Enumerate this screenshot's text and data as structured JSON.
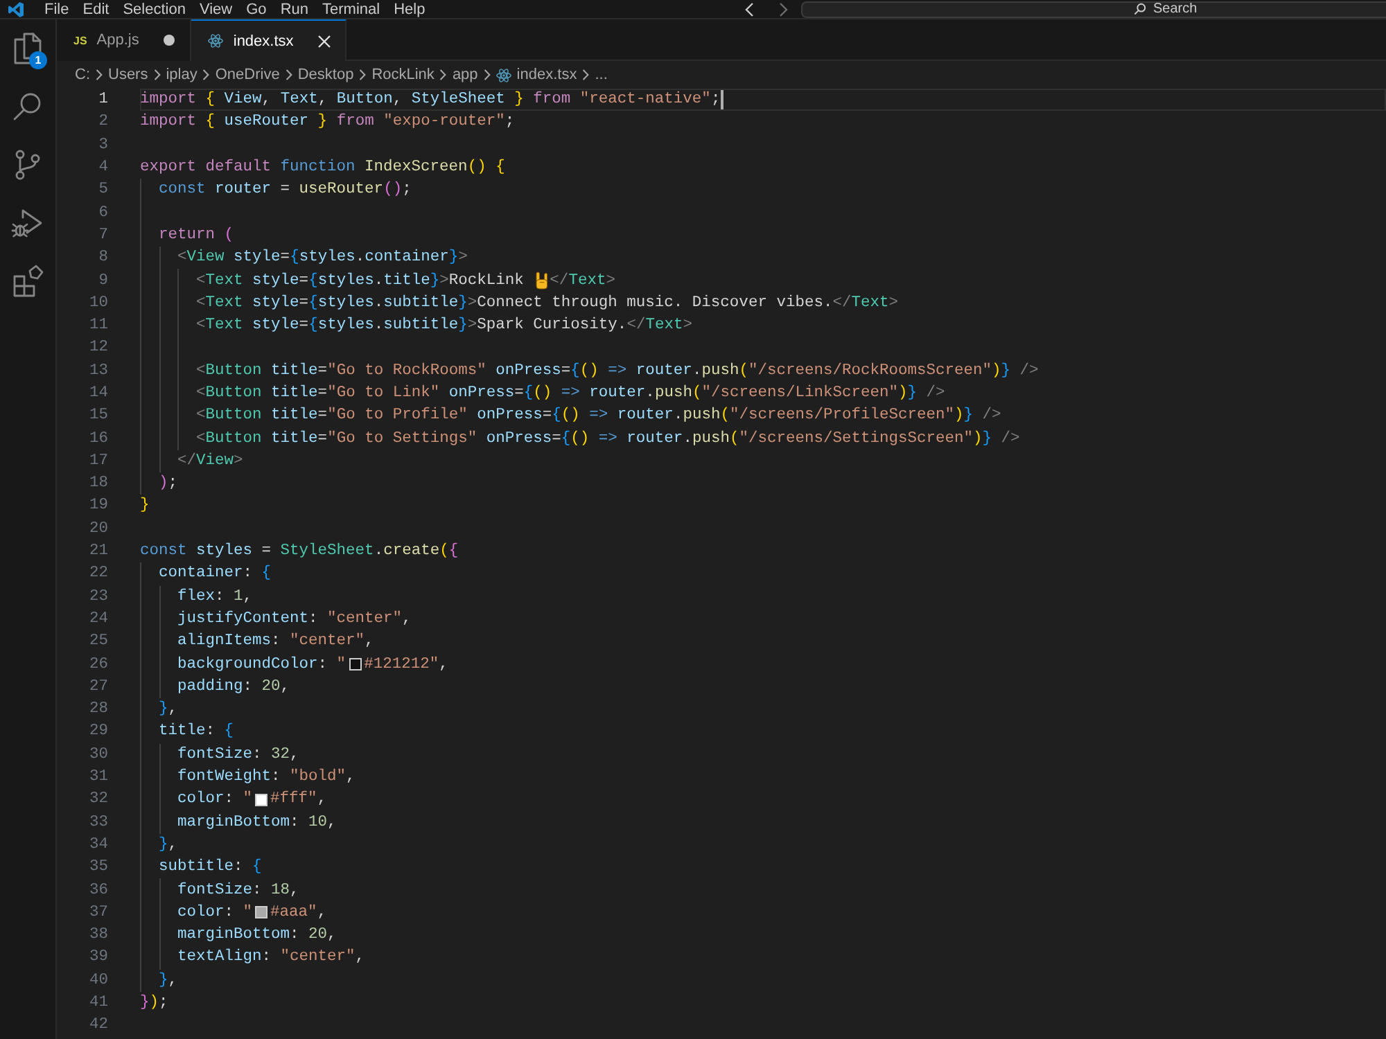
{
  "title_bar": {
    "menu": [
      "File",
      "Edit",
      "Selection",
      "View",
      "Go",
      "Run",
      "Terminal",
      "Help"
    ],
    "search": {
      "placeholder": "Search"
    }
  },
  "activity_bar": {
    "items": [
      {
        "kind": "explorer",
        "badge": "1"
      },
      {
        "kind": "search"
      },
      {
        "kind": "source_control"
      },
      {
        "kind": "run_debug"
      },
      {
        "kind": "extensions"
      }
    ]
  },
  "tabs": [
    {
      "kind": "js",
      "icon_text": "JS",
      "label": "App.js",
      "selected": false,
      "modified": true
    },
    {
      "kind": "react",
      "label": "index.tsx",
      "selected": true,
      "modified": false
    }
  ],
  "breadcrumbs": [
    {
      "kind": "segment",
      "label": "C:"
    },
    {
      "kind": "segment",
      "label": "Users"
    },
    {
      "kind": "segment",
      "label": "iplay"
    },
    {
      "kind": "segment",
      "label": "OneDrive"
    },
    {
      "kind": "segment",
      "label": "Desktop"
    },
    {
      "kind": "segment",
      "label": "RockLink"
    },
    {
      "kind": "segment",
      "label": "app"
    },
    {
      "kind": "file",
      "label": "index.tsx"
    },
    {
      "kind": "segment",
      "label": "..."
    }
  ],
  "editor": {
    "lines": [
      {
        "number": "1",
        "current": true,
        "tokens": [
          {
            "kind": "keyword",
            "text": "import "
          },
          {
            "kind": "bracket1",
            "text": "{"
          },
          {
            "kind": "variable",
            "text": " View"
          },
          {
            "kind": "plain",
            "text": ","
          },
          {
            "kind": "variable",
            "text": " Text"
          },
          {
            "kind": "plain",
            "text": ","
          },
          {
            "kind": "variable",
            "text": " Button"
          },
          {
            "kind": "plain",
            "text": ","
          },
          {
            "kind": "variable",
            "text": " StyleSheet "
          },
          {
            "kind": "bracket1",
            "text": "}"
          },
          {
            "kind": "keyword",
            "text": " from "
          },
          {
            "kind": "string",
            "text": "\"react-native\""
          },
          {
            "kind": "plain",
            "text": ";"
          }
        ]
      },
      {
        "number": "2",
        "current": false,
        "tokens": [
          {
            "kind": "keyword",
            "text": "import "
          },
          {
            "kind": "bracket1",
            "text": "{"
          },
          {
            "kind": "variable",
            "text": " useRouter "
          },
          {
            "kind": "bracket1",
            "text": "}"
          },
          {
            "kind": "keyword",
            "text": " from "
          },
          {
            "kind": "string",
            "text": "\"expo-router\""
          },
          {
            "kind": "plain",
            "text": ";"
          }
        ]
      },
      {
        "number": "3",
        "current": false
      },
      {
        "number": "4",
        "current": false,
        "tokens": [
          {
            "kind": "keyword",
            "text": "export default "
          },
          {
            "kind": "storage",
            "text": "function "
          },
          {
            "kind": "function",
            "text": "IndexScreen"
          },
          {
            "kind": "bracket1",
            "text": "() {"
          }
        ]
      },
      {
        "number": "5",
        "current": false,
        "tokens": [
          {
            "kind": "storage",
            "text": "  const "
          },
          {
            "kind": "variable",
            "text": "router"
          },
          {
            "kind": "plain",
            "text": " = "
          },
          {
            "kind": "function",
            "text": "useRouter"
          },
          {
            "kind": "bracket2",
            "text": "()"
          },
          {
            "kind": "plain",
            "text": ";"
          }
        ]
      },
      {
        "number": "6",
        "current": false
      },
      {
        "number": "7",
        "current": false,
        "tokens": [
          {
            "kind": "keyword",
            "text": "  return "
          },
          {
            "kind": "bracket2",
            "text": "("
          }
        ]
      },
      {
        "number": "8",
        "current": false,
        "tokens": [
          {
            "kind": "punctuation",
            "text": "    <"
          },
          {
            "kind": "tag",
            "text": "View"
          },
          {
            "kind": "variable",
            "text": " style"
          },
          {
            "kind": "plain",
            "text": "="
          },
          {
            "kind": "bracket3",
            "text": "{"
          },
          {
            "kind": "variable",
            "text": "styles"
          },
          {
            "kind": "plain",
            "text": "."
          },
          {
            "kind": "variable",
            "text": "container"
          },
          {
            "kind": "bracket3",
            "text": "}"
          },
          {
            "kind": "punctuation",
            "text": ">"
          }
        ]
      },
      {
        "number": "9",
        "current": false,
        "tokens": [
          {
            "kind": "punctuation",
            "text": "      <"
          },
          {
            "kind": "tag",
            "text": "Text"
          },
          {
            "kind": "variable",
            "text": " style"
          },
          {
            "kind": "plain",
            "text": "="
          },
          {
            "kind": "bracket3",
            "text": "{"
          },
          {
            "kind": "variable",
            "text": "styles"
          },
          {
            "kind": "plain",
            "text": "."
          },
          {
            "kind": "variable",
            "text": "title"
          },
          {
            "kind": "bracket3",
            "text": "}"
          },
          {
            "kind": "punctuation",
            "text": ">"
          },
          {
            "kind": "plain",
            "text": "RockLink "
          },
          {
            "kind": "emoji"
          },
          {
            "kind": "punctuation",
            "text": "</"
          },
          {
            "kind": "tag",
            "text": "Text"
          },
          {
            "kind": "punctuation",
            "text": ">"
          }
        ]
      },
      {
        "number": "10",
        "current": false,
        "tokens": [
          {
            "kind": "punctuation",
            "text": "      <"
          },
          {
            "kind": "tag",
            "text": "Text"
          },
          {
            "kind": "variable",
            "text": " style"
          },
          {
            "kind": "plain",
            "text": "="
          },
          {
            "kind": "bracket3",
            "text": "{"
          },
          {
            "kind": "variable",
            "text": "styles"
          },
          {
            "kind": "plain",
            "text": "."
          },
          {
            "kind": "variable",
            "text": "subtitle"
          },
          {
            "kind": "bracket3",
            "text": "}"
          },
          {
            "kind": "punctuation",
            "text": ">"
          },
          {
            "kind": "plain",
            "text": "Connect through music. Discover vibes."
          },
          {
            "kind": "punctuation",
            "text": "</"
          },
          {
            "kind": "tag",
            "text": "Text"
          },
          {
            "kind": "punctuation",
            "text": ">"
          }
        ]
      },
      {
        "number": "11",
        "current": false,
        "tokens": [
          {
            "kind": "punctuation",
            "text": "      <"
          },
          {
            "kind": "tag",
            "text": "Text"
          },
          {
            "kind": "variable",
            "text": " style"
          },
          {
            "kind": "plain",
            "text": "="
          },
          {
            "kind": "bracket3",
            "text": "{"
          },
          {
            "kind": "variable",
            "text": "styles"
          },
          {
            "kind": "plain",
            "text": "."
          },
          {
            "kind": "variable",
            "text": "subtitle"
          },
          {
            "kind": "bracket3",
            "text": "}"
          },
          {
            "kind": "punctuation",
            "text": ">"
          },
          {
            "kind": "plain",
            "text": "Spark Curiosity."
          },
          {
            "kind": "punctuation",
            "text": "</"
          },
          {
            "kind": "tag",
            "text": "Text"
          },
          {
            "kind": "punctuation",
            "text": ">"
          }
        ]
      },
      {
        "number": "12",
        "current": false
      },
      {
        "number": "13",
        "current": false,
        "tokens": [
          {
            "kind": "punctuation",
            "text": "      <"
          },
          {
            "kind": "tag",
            "text": "Button"
          },
          {
            "kind": "variable",
            "text": " title"
          },
          {
            "kind": "plain",
            "text": "="
          },
          {
            "kind": "string",
            "text": "\"Go to RockRooms\""
          },
          {
            "kind": "variable",
            "text": " onPress"
          },
          {
            "kind": "plain",
            "text": "="
          },
          {
            "kind": "bracket3",
            "text": "{"
          },
          {
            "kind": "bracket1",
            "text": "()"
          },
          {
            "kind": "storage",
            "text": " => "
          },
          {
            "kind": "variable",
            "text": "router"
          },
          {
            "kind": "plain",
            "text": "."
          },
          {
            "kind": "function",
            "text": "push"
          },
          {
            "kind": "bracket1",
            "text": "("
          },
          {
            "kind": "string",
            "text": "\"/screens/RockRoomsScreen\""
          },
          {
            "kind": "bracket1",
            "text": ")"
          },
          {
            "kind": "bracket3",
            "text": "}"
          },
          {
            "kind": "punctuation",
            "text": " />"
          }
        ]
      },
      {
        "number": "14",
        "current": false,
        "tokens": [
          {
            "kind": "punctuation",
            "text": "      <"
          },
          {
            "kind": "tag",
            "text": "Button"
          },
          {
            "kind": "variable",
            "text": " title"
          },
          {
            "kind": "plain",
            "text": "="
          },
          {
            "kind": "string",
            "text": "\"Go to Link\""
          },
          {
            "kind": "variable",
            "text": " onPress"
          },
          {
            "kind": "plain",
            "text": "="
          },
          {
            "kind": "bracket3",
            "text": "{"
          },
          {
            "kind": "bracket1",
            "text": "()"
          },
          {
            "kind": "storage",
            "text": " => "
          },
          {
            "kind": "variable",
            "text": "router"
          },
          {
            "kind": "plain",
            "text": "."
          },
          {
            "kind": "function",
            "text": "push"
          },
          {
            "kind": "bracket1",
            "text": "("
          },
          {
            "kind": "string",
            "text": "\"/screens/LinkScreen\""
          },
          {
            "kind": "bracket1",
            "text": ")"
          },
          {
            "kind": "bracket3",
            "text": "}"
          },
          {
            "kind": "punctuation",
            "text": " />"
          }
        ]
      },
      {
        "number": "15",
        "current": false,
        "tokens": [
          {
            "kind": "punctuation",
            "text": "      <"
          },
          {
            "kind": "tag",
            "text": "Button"
          },
          {
            "kind": "variable",
            "text": " title"
          },
          {
            "kind": "plain",
            "text": "="
          },
          {
            "kind": "string",
            "text": "\"Go to Profile\""
          },
          {
            "kind": "variable",
            "text": " onPress"
          },
          {
            "kind": "plain",
            "text": "="
          },
          {
            "kind": "bracket3",
            "text": "{"
          },
          {
            "kind": "bracket1",
            "text": "()"
          },
          {
            "kind": "storage",
            "text": " => "
          },
          {
            "kind": "variable",
            "text": "router"
          },
          {
            "kind": "plain",
            "text": "."
          },
          {
            "kind": "function",
            "text": "push"
          },
          {
            "kind": "bracket1",
            "text": "("
          },
          {
            "kind": "string",
            "text": "\"/screens/ProfileScreen\""
          },
          {
            "kind": "bracket1",
            "text": ")"
          },
          {
            "kind": "bracket3",
            "text": "}"
          },
          {
            "kind": "punctuation",
            "text": " />"
          }
        ]
      },
      {
        "number": "16",
        "current": false,
        "tokens": [
          {
            "kind": "punctuation",
            "text": "      <"
          },
          {
            "kind": "tag",
            "text": "Button"
          },
          {
            "kind": "variable",
            "text": " title"
          },
          {
            "kind": "plain",
            "text": "="
          },
          {
            "kind": "string",
            "text": "\"Go to Settings\""
          },
          {
            "kind": "variable",
            "text": " onPress"
          },
          {
            "kind": "plain",
            "text": "="
          },
          {
            "kind": "bracket3",
            "text": "{"
          },
          {
            "kind": "bracket1",
            "text": "()"
          },
          {
            "kind": "storage",
            "text": " => "
          },
          {
            "kind": "variable",
            "text": "router"
          },
          {
            "kind": "plain",
            "text": "."
          },
          {
            "kind": "function",
            "text": "push"
          },
          {
            "kind": "bracket1",
            "text": "("
          },
          {
            "kind": "string",
            "text": "\"/screens/SettingsScreen\""
          },
          {
            "kind": "bracket1",
            "text": ")"
          },
          {
            "kind": "bracket3",
            "text": "}"
          },
          {
            "kind": "punctuation",
            "text": " />"
          }
        ]
      },
      {
        "number": "17",
        "current": false,
        "tokens": [
          {
            "kind": "punctuation",
            "text": "    </"
          },
          {
            "kind": "tag",
            "text": "View"
          },
          {
            "kind": "punctuation",
            "text": ">"
          }
        ]
      },
      {
        "number": "18",
        "current": false,
        "tokens": [
          {
            "kind": "bracket2",
            "text": "  )"
          },
          {
            "kind": "plain",
            "text": ";"
          }
        ]
      },
      {
        "number": "19",
        "current": false,
        "tokens": [
          {
            "kind": "bracket1",
            "text": "}"
          }
        ]
      },
      {
        "number": "20",
        "current": false
      },
      {
        "number": "21",
        "current": false,
        "tokens": [
          {
            "kind": "storage",
            "text": "const "
          },
          {
            "kind": "variable",
            "text": "styles"
          },
          {
            "kind": "plain",
            "text": " = "
          },
          {
            "kind": "type",
            "text": "StyleSheet"
          },
          {
            "kind": "plain",
            "text": "."
          },
          {
            "kind": "function",
            "text": "create"
          },
          {
            "kind": "bracket1",
            "text": "("
          },
          {
            "kind": "bracket2",
            "text": "{"
          }
        ]
      },
      {
        "number": "22",
        "current": false,
        "tokens": [
          {
            "kind": "variable",
            "text": "  container"
          },
          {
            "kind": "plain",
            "text": ": "
          },
          {
            "kind": "bracket3",
            "text": "{"
          }
        ]
      },
      {
        "number": "23",
        "current": false,
        "tokens": [
          {
            "kind": "variable",
            "text": "    flex"
          },
          {
            "kind": "plain",
            "text": ": "
          },
          {
            "kind": "number",
            "text": "1"
          },
          {
            "kind": "plain",
            "text": ","
          }
        ]
      },
      {
        "number": "24",
        "current": false,
        "tokens": [
          {
            "kind": "variable",
            "text": "    justifyContent"
          },
          {
            "kind": "plain",
            "text": ": "
          },
          {
            "kind": "string",
            "text": "\"center\""
          },
          {
            "kind": "plain",
            "text": ","
          }
        ]
      },
      {
        "number": "25",
        "current": false,
        "tokens": [
          {
            "kind": "variable",
            "text": "    alignItems"
          },
          {
            "kind": "plain",
            "text": ": "
          },
          {
            "kind": "string",
            "text": "\"center\""
          },
          {
            "kind": "plain",
            "text": ","
          }
        ]
      },
      {
        "number": "26",
        "current": false,
        "tokens": [
          {
            "kind": "variable",
            "text": "    backgroundColor"
          },
          {
            "kind": "plain",
            "text": ": "
          },
          {
            "kind": "string",
            "text": "\""
          },
          {
            "kind": "swatch",
            "color": "#121212"
          },
          {
            "kind": "string",
            "text": "#121212\""
          },
          {
            "kind": "plain",
            "text": ","
          }
        ]
      },
      {
        "number": "27",
        "current": false,
        "tokens": [
          {
            "kind": "variable",
            "text": "    padding"
          },
          {
            "kind": "plain",
            "text": ": "
          },
          {
            "kind": "number",
            "text": "20"
          },
          {
            "kind": "plain",
            "text": ","
          }
        ]
      },
      {
        "number": "28",
        "current": false,
        "tokens": [
          {
            "kind": "bracket3",
            "text": "  }"
          },
          {
            "kind": "plain",
            "text": ","
          }
        ]
      },
      {
        "number": "29",
        "current": false,
        "tokens": [
          {
            "kind": "variable",
            "text": "  title"
          },
          {
            "kind": "plain",
            "text": ": "
          },
          {
            "kind": "bracket3",
            "text": "{"
          }
        ]
      },
      {
        "number": "30",
        "current": false,
        "tokens": [
          {
            "kind": "variable",
            "text": "    fontSize"
          },
          {
            "kind": "plain",
            "text": ": "
          },
          {
            "kind": "number",
            "text": "32"
          },
          {
            "kind": "plain",
            "text": ","
          }
        ]
      },
      {
        "number": "31",
        "current": false,
        "tokens": [
          {
            "kind": "variable",
            "text": "    fontWeight"
          },
          {
            "kind": "plain",
            "text": ": "
          },
          {
            "kind": "string",
            "text": "\"bold\""
          },
          {
            "kind": "plain",
            "text": ","
          }
        ]
      },
      {
        "number": "32",
        "current": false,
        "tokens": [
          {
            "kind": "variable",
            "text": "    color"
          },
          {
            "kind": "plain",
            "text": ": "
          },
          {
            "kind": "string",
            "text": "\""
          },
          {
            "kind": "swatch",
            "color": "#ffffff"
          },
          {
            "kind": "string",
            "text": "#fff\""
          },
          {
            "kind": "plain",
            "text": ","
          }
        ]
      },
      {
        "number": "33",
        "current": false,
        "tokens": [
          {
            "kind": "variable",
            "text": "    marginBottom"
          },
          {
            "kind": "plain",
            "text": ": "
          },
          {
            "kind": "number",
            "text": "10"
          },
          {
            "kind": "plain",
            "text": ","
          }
        ]
      },
      {
        "number": "34",
        "current": false,
        "tokens": [
          {
            "kind": "bracket3",
            "text": "  }"
          },
          {
            "kind": "plain",
            "text": ","
          }
        ]
      },
      {
        "number": "35",
        "current": false,
        "tokens": [
          {
            "kind": "variable",
            "text": "  subtitle"
          },
          {
            "kind": "plain",
            "text": ": "
          },
          {
            "kind": "bracket3",
            "text": "{"
          }
        ]
      },
      {
        "number": "36",
        "current": false,
        "tokens": [
          {
            "kind": "variable",
            "text": "    fontSize"
          },
          {
            "kind": "plain",
            "text": ": "
          },
          {
            "kind": "number",
            "text": "18"
          },
          {
            "kind": "plain",
            "text": ","
          }
        ]
      },
      {
        "number": "37",
        "current": false,
        "tokens": [
          {
            "kind": "variable",
            "text": "    color"
          },
          {
            "kind": "plain",
            "text": ": "
          },
          {
            "kind": "string",
            "text": "\""
          },
          {
            "kind": "swatch",
            "color": "#aaaaaa"
          },
          {
            "kind": "string",
            "text": "#aaa\""
          },
          {
            "kind": "plain",
            "text": ","
          }
        ]
      },
      {
        "number": "38",
        "current": false,
        "tokens": [
          {
            "kind": "variable",
            "text": "    marginBottom"
          },
          {
            "kind": "plain",
            "text": ": "
          },
          {
            "kind": "number",
            "text": "20"
          },
          {
            "kind": "plain",
            "text": ","
          }
        ]
      },
      {
        "number": "39",
        "current": false,
        "tokens": [
          {
            "kind": "variable",
            "text": "    textAlign"
          },
          {
            "kind": "plain",
            "text": ": "
          },
          {
            "kind": "string",
            "text": "\"center\""
          },
          {
            "kind": "plain",
            "text": ","
          }
        ]
      },
      {
        "number": "40",
        "current": false,
        "tokens": [
          {
            "kind": "bracket3",
            "text": "  }"
          },
          {
            "kind": "plain",
            "text": ","
          }
        ]
      },
      {
        "number": "41",
        "current": false,
        "tokens": [
          {
            "kind": "bracket2",
            "text": "}"
          },
          {
            "kind": "bracket1",
            "text": ")"
          },
          {
            "kind": "plain",
            "text": ";"
          }
        ]
      },
      {
        "number": "42",
        "current": false
      }
    ]
  }
}
